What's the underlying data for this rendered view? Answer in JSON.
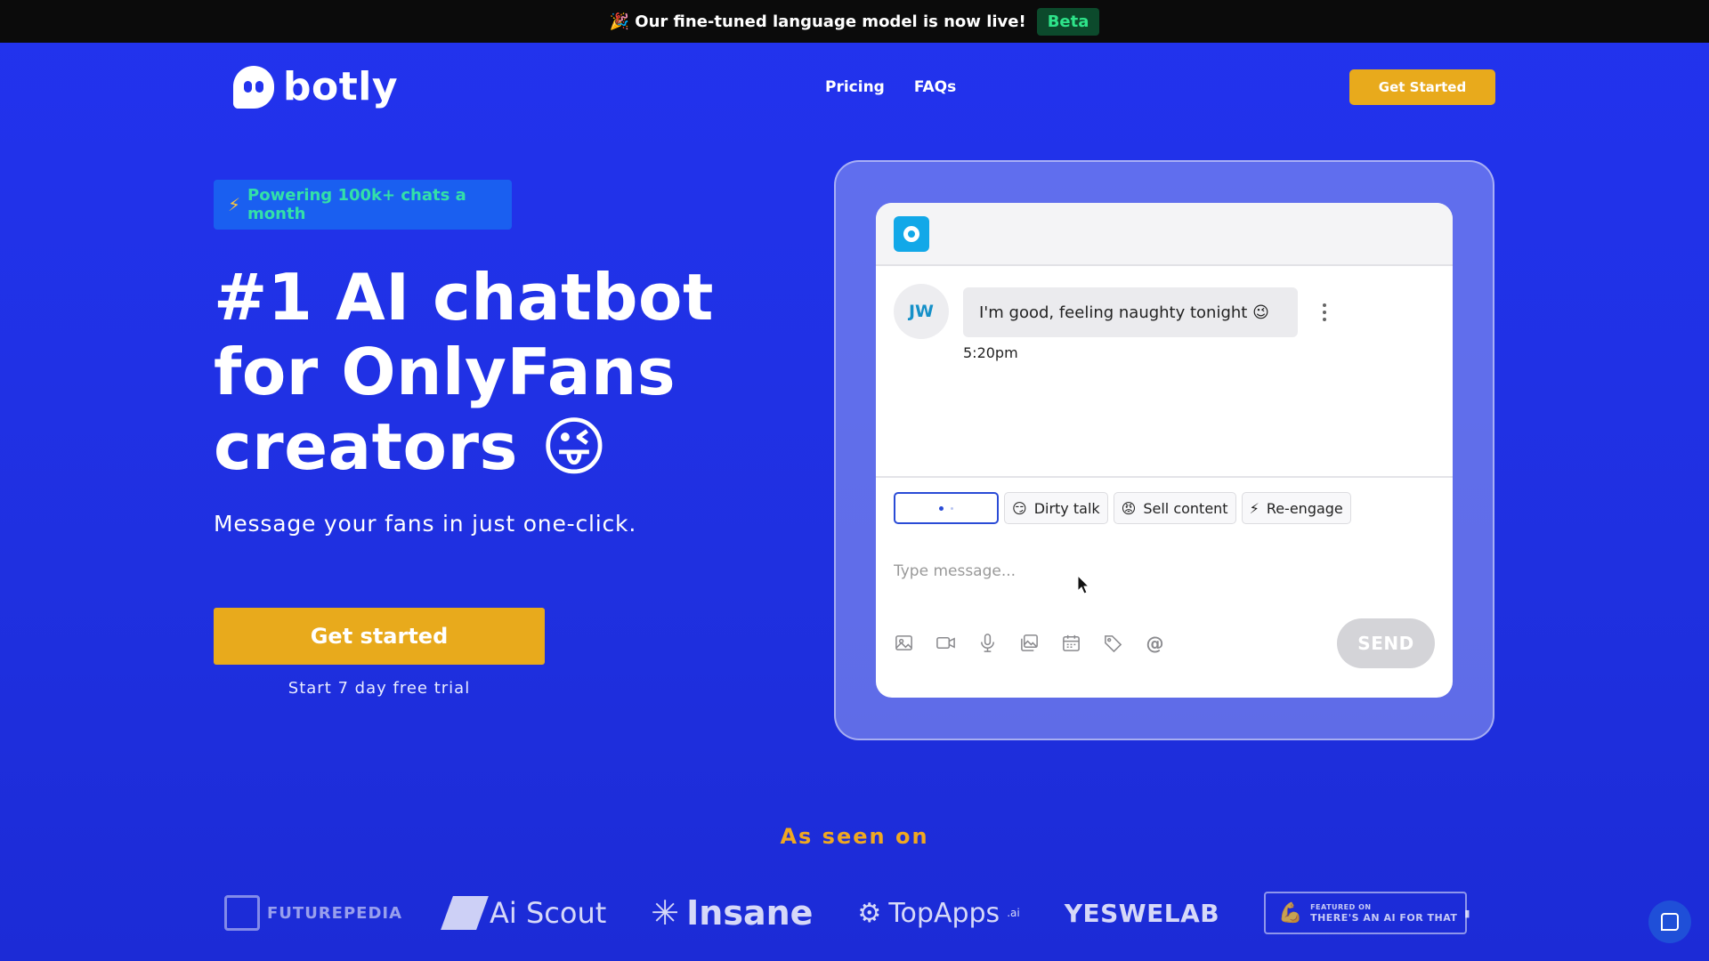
{
  "announcement": {
    "text": "🎉 Our fine-tuned language model is now live!",
    "badge": "Beta"
  },
  "nav": {
    "logo_text": "botly",
    "links": [
      "Pricing",
      "FAQs"
    ],
    "cta": "Get Started"
  },
  "hero": {
    "pill": "Powering 100k+ chats a month",
    "title": "#1 AI chatbot for OnlyFans creators 😜",
    "subtitle": "Message your fans in just one-click.",
    "cta": "Get started",
    "trial_note": "Start 7 day free trial"
  },
  "demo": {
    "avatar_initials": "JW",
    "message": "I'm good, feeling naughty tonight 😉",
    "message_time": "5:20pm",
    "chips": [
      {
        "emoji": "😏",
        "label": "Dirty talk"
      },
      {
        "emoji": "😡",
        "label": "Sell content"
      },
      {
        "emoji": "⚡",
        "label": "Re-engage"
      }
    ],
    "compose_placeholder": "Type message...",
    "send_label": "SEND",
    "tool_icons": [
      "image-icon",
      "video-icon",
      "microphone-icon",
      "gallery-icon",
      "calendar-icon",
      "tag-icon",
      "mention-icon"
    ],
    "mention_symbol": "@"
  },
  "as_seen_on": {
    "title": "As seen on",
    "logos": [
      "FUTUREPEDIA",
      "Ai Scout",
      "Insane",
      "TopApps",
      "YESWELAB",
      "THERE'S AN AI FOR THAT"
    ],
    "aiforthat_prefix": "FEATURED ON",
    "topapps_suffix": ".ai"
  },
  "colors": {
    "background": "#2233ee",
    "accent": "#e8aa1c",
    "pill_text": "#33e0a8",
    "beta_text": "#2ee48a",
    "seen_on_title": "#f0a820"
  }
}
